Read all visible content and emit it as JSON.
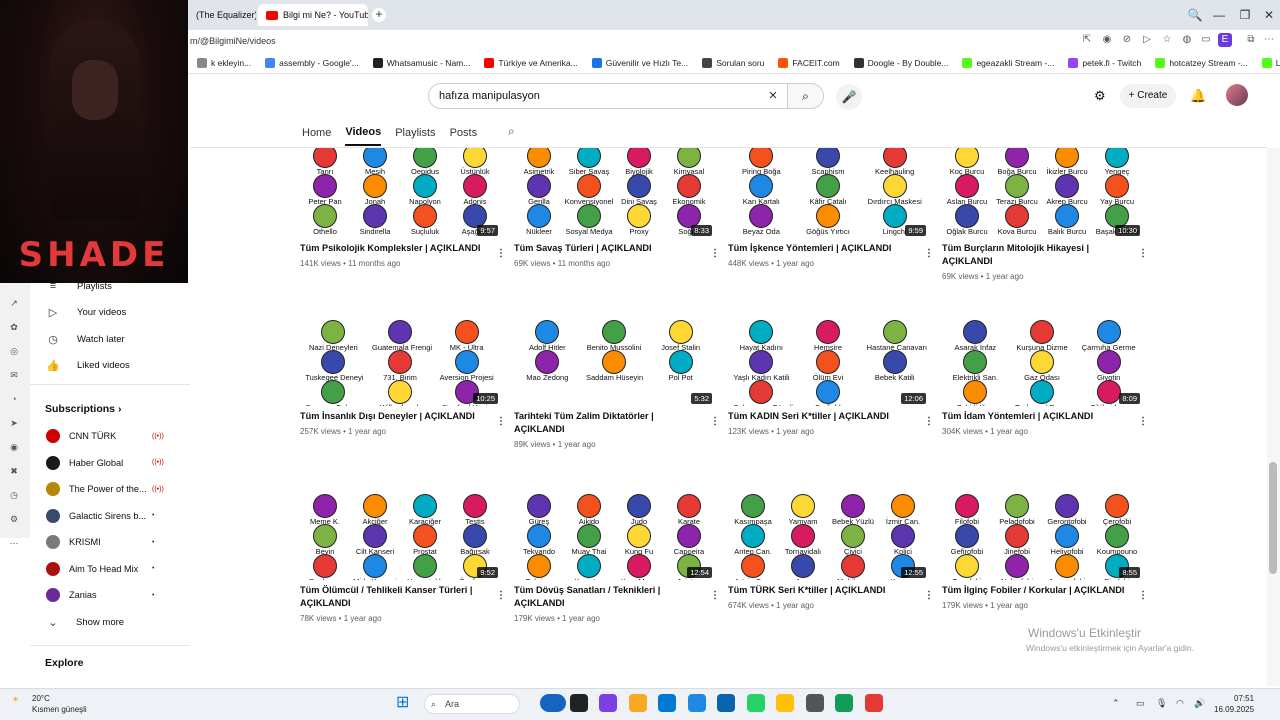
{
  "browser": {
    "tabs": [
      {
        "label": "(The Equalizer) Ta"
      },
      {
        "label": "Bilgi mi Ne? - YouTube"
      }
    ],
    "new_tab": "+",
    "address": "m/@BilgimiNe/videos",
    "bookmarks": [
      {
        "label": "k ekleyin...",
        "color": "#888888"
      },
      {
        "label": "assembly - Google'...",
        "color": "#4285f4"
      },
      {
        "label": "Whatsamusic - Nam...",
        "color": "#222222"
      },
      {
        "label": "Türkiye ve Amerika...",
        "color": "#ff0000"
      },
      {
        "label": "Güvenilir ve Hızlı Te...",
        "color": "#1a73e8"
      },
      {
        "label": "Sorulan soru",
        "color": "#444444"
      },
      {
        "label": "FACEIT.com",
        "color": "#ff5500"
      },
      {
        "label": "Doogle - By Double...",
        "color": "#333333"
      },
      {
        "label": "egeazakli Stream -...",
        "color": "#53fc18"
      },
      {
        "label": "petek.fi - Twitch",
        "color": "#9146ff"
      },
      {
        "label": "hotcatzey Stream -...",
        "color": "#53fc18"
      },
      {
        "label": "L3Lana Stream - Wa...",
        "color": "#53fc18"
      }
    ]
  },
  "overlay": {
    "brand": "SHADE"
  },
  "youtube": {
    "search_value": "hafıza manipulasyon",
    "create_label": "Create",
    "channel_tabs": [
      "Home",
      "Videos",
      "Playlists",
      "Posts"
    ],
    "selected_tab": "Videos"
  },
  "sidebar": {
    "items": [
      {
        "label": "Playlists",
        "icon": "playlist-icon"
      },
      {
        "label": "Your videos",
        "icon": "play-icon"
      },
      {
        "label": "Watch later",
        "icon": "clock-icon"
      },
      {
        "label": "Liked videos",
        "icon": "thumb-up-icon"
      }
    ],
    "subscriptions_label": "Subscriptions",
    "subscriptions": [
      {
        "label": "CNN TÜRK",
        "color": "#cc0000",
        "live": true
      },
      {
        "label": "Haber Global",
        "color": "#1a1a1a",
        "live": true
      },
      {
        "label": "The Power of the...",
        "color": "#b8860b",
        "live": true
      },
      {
        "label": "Galactic Sirens b...",
        "color": "#3a4a6a",
        "live": false
      },
      {
        "label": "KRISMI",
        "color": "#7a7a7a",
        "live": false
      },
      {
        "label": "Aim To Head Mix",
        "color": "#aa1111",
        "live": false
      },
      {
        "label": "Zanias",
        "color": "#6a2a9a",
        "live": false
      }
    ],
    "show_more": "Show more",
    "explore_label": "Explore"
  },
  "videos": [
    {
      "title": "Tüm Psikolojik Kompleksler | AÇIKLANDI",
      "meta": "141K views • 11 months ago",
      "duration": "9:57",
      "labels": [
        "Tanrı",
        "Mesih",
        "Oepidus",
        "Üstünlük",
        "Peter Pan",
        "Jonah",
        "Napolyon",
        "Adonis",
        "Othello",
        "Sindirella",
        "Suçluluk",
        "Aşağılık"
      ]
    },
    {
      "title": "Tüm Savaş Türleri | AÇIKLANDI",
      "meta": "69K views • 11 months ago",
      "duration": "8:33",
      "labels": [
        "Asimetrik",
        "Siber Savaş",
        "Biyolojik",
        "Kimyasal",
        "Gerilla",
        "Konvensiyonel",
        "Dini Savaş",
        "Ekonomik",
        "Nükleer",
        "Sosyal Medya",
        "Proxy",
        "Soğuk"
      ]
    },
    {
      "title": "Tüm İşkence Yöntemleri | AÇIKLANDI",
      "meta": "448K views • 1 year ago",
      "duration": "9:59",
      "labels": [
        "Piring Boğa",
        "Scaphism",
        "Keelhauling",
        "Kan Kartalı",
        "Kâfir Çatalı",
        "Dırdırcı Maskesi",
        "Beyaz Oda",
        "Göğüs Yırtıcı",
        "Lingchi"
      ]
    },
    {
      "title": "Tüm Burçların Mitolojik Hikayesi | AÇIKLANDI",
      "meta": "69K views • 1 year ago",
      "duration": "10:30",
      "labels": [
        "Koç Burcu",
        "Boğa Burcu",
        "İkizler Burcu",
        "Yengeç",
        "Aslan Burcu",
        "Terazi Burcu",
        "Akrep Burcu",
        "Yay Burcu",
        "Oğlak Burcu",
        "Kova Burcu",
        "Balık Burcu",
        "Başak Burcu"
      ]
    },
    {
      "title": "Tüm İnsanlık Dışı Deneyler | AÇIKLANDI",
      "meta": "257K views • 1 year ago",
      "duration": "10:25",
      "labels": [
        "Nazi Deneyleri",
        "Guatemala Frengi",
        "MK - Ultra",
        "Tuskegee Deneyi",
        "731. Birim",
        "Aversion Projesi",
        "Canavar Çalışma",
        "Willowbrook",
        "Stanford Hapis"
      ]
    },
    {
      "title": "Tarihteki Tüm Zalim Diktatörler | AÇIKLANDI",
      "meta": "89K views • 1 year ago",
      "duration": "5:32",
      "labels": [
        "Adolf Hitler",
        "Benito Mussolini",
        "Josef Stalin",
        "Mao Zedong",
        "Saddam Hüseyin",
        "Pol Pot"
      ]
    },
    {
      "title": "Tüm KADIN Seri K*tiller | AÇIKLANDI",
      "meta": "123K views • 1 year ago",
      "duration": "12:06",
      "labels": [
        "Hayat Kadını",
        "Hemşire",
        "Hastane Canavarı",
        "Yaşlı Kadın Katili",
        "Ölüm Evi",
        "Bebek Katili",
        "Cehennem Güzeli",
        "Barfield"
      ]
    },
    {
      "title": "Tüm İdam Yöntemleri | AÇIKLANDI",
      "meta": "304K views • 1 year ago",
      "duration": "8:09",
      "labels": [
        "Asarak İnfaz",
        "Kurşuna Dizme",
        "Çarmıha Germe",
        "Elektrikli San.",
        "Gaz Odası",
        "Giyotin",
        "Zehirli İğne",
        "Taşlama / Recm",
        "Fil ile idam"
      ]
    },
    {
      "title": "Tüm Ölümcül / Tehlikeli Kanser Türleri | AÇIKLANDI",
      "meta": "78K views • 1 year ago",
      "duration": "9:52",
      "labels": [
        "Meme K.",
        "Akciğer",
        "Karaciğer",
        "Testis",
        "Beyin",
        "Cilt Kanseri",
        "Prostat",
        "Bağırsak",
        "Pankreas",
        "Mide Kanseri",
        "Yumurtalık",
        "Özofagus"
      ]
    },
    {
      "title": "Tüm Dövüş Sanatları / Teknikleri | AÇIKLANDI",
      "meta": "179K views • 1 year ago",
      "duration": "12:54",
      "labels": [
        "Güreş",
        "Aikido",
        "Judo",
        "Karate",
        "Tekvando",
        "Muay Thai",
        "Kung Fu",
        "Capoeira",
        "Eskrima",
        "Kenjutsu",
        "Krav Maga",
        "Jujutsu"
      ]
    },
    {
      "title": "Tüm TÜRK Seri K*tiller | AÇIKLANDI",
      "meta": "674K views • 1 year ago",
      "duration": "12:55",
      "labels": [
        "Kasımpaşa",
        "Yamyam",
        "Bebek Yüzlü",
        "İzmir Can.",
        "Antep Can.",
        "Tornavidalı",
        "Çivici",
        "Kolici",
        "Artvin Can.",
        "Avcı",
        "Mobilyacı",
        "Kuyucu"
      ]
    },
    {
      "title": "Tüm İlginç Fobiler / Korkular | AÇIKLANDI",
      "meta": "179K views • 1 year ago",
      "duration": "8:55",
      "labels": [
        "Filofobi",
        "Peladofobi",
        "Gerontofobi",
        "Çerofobi",
        "Gefirofobi",
        "Jinefobi",
        "Heliyofobi",
        "Koumpouno",
        "Zenofobi",
        "Nekrofobi",
        "Japanofobi",
        "Pirofobi"
      ]
    }
  ],
  "watermark": {
    "line1": "Windows'u Etkinleştir",
    "line2": "Windows'u etkinleştirmek için Ayarlar'a gidin."
  },
  "taskbar": {
    "temp": "20°C",
    "weather": "Kısmen güneşli",
    "search_placeholder": "Ara",
    "time": "07:51",
    "date": "16.09.2025"
  },
  "palette": [
    "#e53935",
    "#1e88e5",
    "#43a047",
    "#fdd835",
    "#8e24aa",
    "#fb8c00",
    "#00acc1",
    "#d81b60",
    "#7cb342",
    "#5e35b1",
    "#f4511e",
    "#3949ab"
  ]
}
